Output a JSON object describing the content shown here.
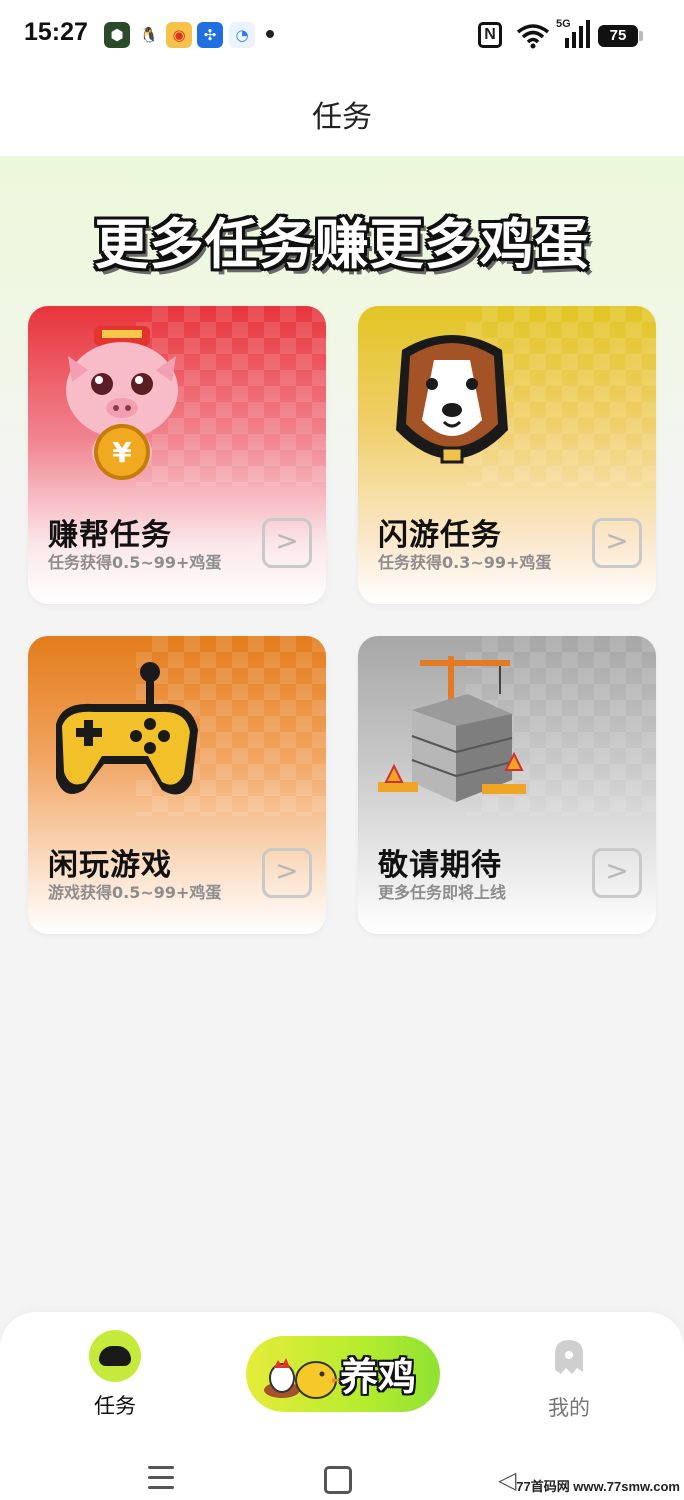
{
  "status_bar": {
    "time": "15:27",
    "battery": "75",
    "network": "5G",
    "nfc": "N"
  },
  "header": {
    "title": "任务"
  },
  "banner": {
    "text": "更多任务赚更多鸡蛋"
  },
  "cards": [
    {
      "title": "赚帮任务",
      "subtitle": "任务获得0.5~99+鸡蛋",
      "icon": "pig-coin-icon",
      "color": "#e8343b"
    },
    {
      "title": "闪游任务",
      "subtitle": "任务获得0.3~99+鸡蛋",
      "icon": "dog-icon",
      "color": "#e2c524"
    },
    {
      "title": "闲玩游戏",
      "subtitle": "游戏获得0.5~99+鸡蛋",
      "icon": "gamepad-icon",
      "color": "#e27c1b"
    },
    {
      "title": "敬请期待",
      "subtitle": "更多任务即将上线",
      "icon": "construction-icon",
      "color": "#a7a7a7"
    }
  ],
  "bottom_nav": {
    "task_label": "任务",
    "raise_label": "养鸡",
    "me_label": "我的",
    "accent": "#c6ea3b"
  },
  "watermark": "77首码网 www.77smw.com"
}
